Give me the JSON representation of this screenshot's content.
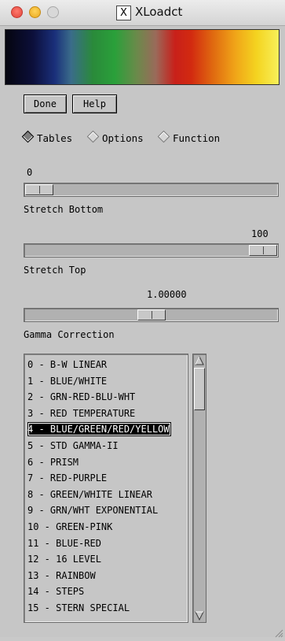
{
  "window": {
    "title": "XLoadct",
    "x_icon": "X"
  },
  "buttons": {
    "done": "Done",
    "help": "Help"
  },
  "modes": {
    "tables": "Tables",
    "options": "Options",
    "function": "Function",
    "selected": "Tables"
  },
  "sliders": {
    "bottom": {
      "value": "0",
      "label": "Stretch Bottom",
      "fraction": 0.0
    },
    "top": {
      "value": "100",
      "label": "Stretch Top",
      "fraction": 1.0
    },
    "gamma": {
      "value": "1.00000",
      "label": "Gamma Correction",
      "fraction": 0.5
    }
  },
  "tables": {
    "selected_index": 4,
    "items": [
      "0 - B-W LINEAR",
      "1 - BLUE/WHITE",
      "2 - GRN-RED-BLU-WHT",
      "3 - RED TEMPERATURE",
      "4 - BLUE/GREEN/RED/YELLOW",
      "5 - STD GAMMA-II",
      "6 - PRISM",
      "7 - RED-PURPLE",
      "8 - GREEN/WHITE LINEAR",
      "9 - GRN/WHT EXPONENTIAL",
      "10 - GREEN-PINK",
      "11 - BLUE-RED",
      "12 - 16 LEVEL",
      "13 - RAINBOW",
      "14 - STEPS",
      "15 - STERN SPECIAL"
    ]
  },
  "colors": {
    "window_bg": "#c6c6c6",
    "selection_bg": "#000000",
    "selection_fg": "#ffffff"
  },
  "icons": {
    "close": "close-icon",
    "minimize": "minimize-icon",
    "zoom": "zoom-icon",
    "scroll_up": "arrow-up-icon",
    "scroll_down": "arrow-down-icon",
    "resize": "resize-grip-icon"
  }
}
